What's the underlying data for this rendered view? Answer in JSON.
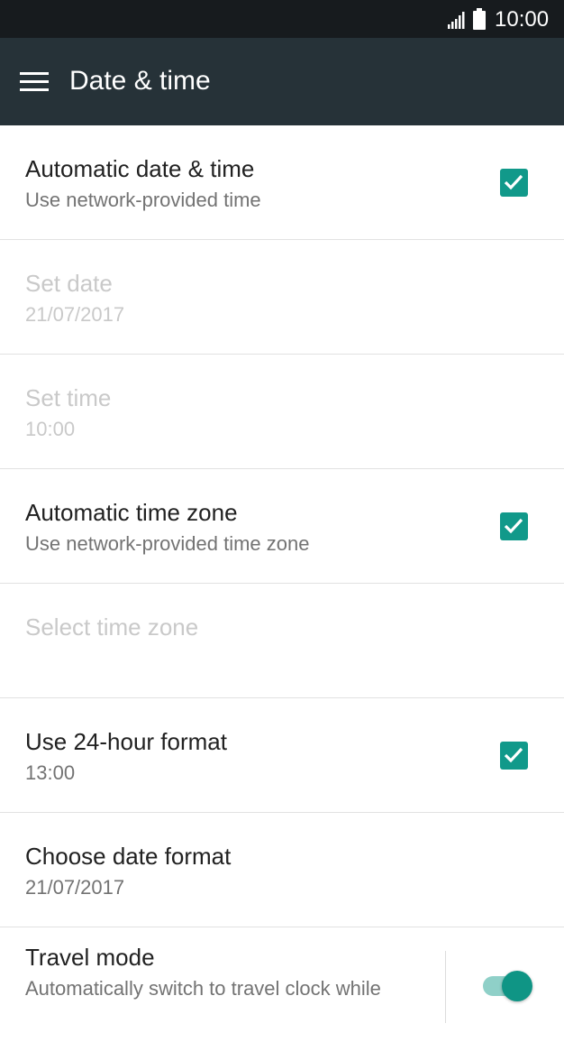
{
  "status_bar": {
    "time": "10:00",
    "signal_icon": "signal-icon",
    "battery_icon": "battery-icon"
  },
  "app_bar": {
    "title": "Date & time",
    "menu_icon": "menu-icon",
    "color": "#263238"
  },
  "accent_color": "#11998a",
  "settings": {
    "automatic_date_time": {
      "title": "Automatic date & time",
      "subtitle": "Use network-provided time",
      "checked": true
    },
    "set_date": {
      "title": "Set date",
      "subtitle": "21/07/2017",
      "enabled": false
    },
    "set_time": {
      "title": "Set time",
      "subtitle": "10:00",
      "enabled": false
    },
    "automatic_time_zone": {
      "title": "Automatic time zone",
      "subtitle": "Use network-provided time zone",
      "checked": true
    },
    "select_time_zone": {
      "title": "Select time zone",
      "enabled": false
    },
    "use_24_hour": {
      "title": "Use 24-hour format",
      "subtitle": "13:00",
      "checked": true
    },
    "date_format": {
      "title": "Choose date format",
      "subtitle": "21/07/2017"
    },
    "travel_mode": {
      "title": "Travel mode",
      "subtitle": "Automatically switch to travel clock while",
      "toggle_on": true
    }
  }
}
